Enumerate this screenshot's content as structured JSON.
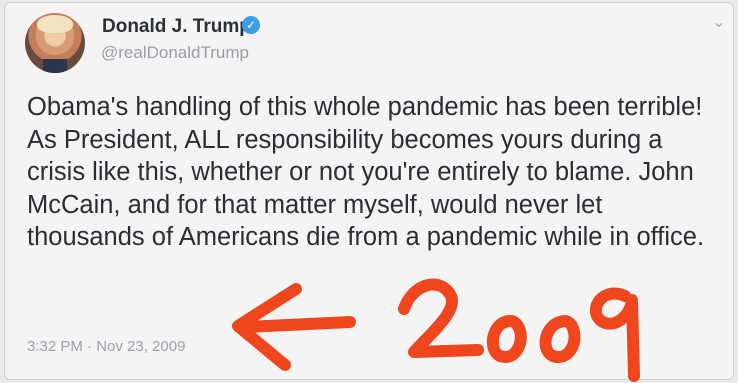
{
  "tweet": {
    "author_name": "Donald J. Trump",
    "author_handle": "@realDonaldTrump",
    "verified_icon": "verified-badge-icon",
    "menu_icon": "chevron-down-icon",
    "text": "Obama's handling of this whole pandemic has been terrible! As President, ALL responsibility becomes yours during a crisis like this, whether or not you're entirely to blame. John McCain, and for that matter myself, would never let thousands of Americans die from a pandemic while in office.",
    "timestamp": "3:32 PM · Nov 23, 2009"
  },
  "annotation": {
    "handwritten_text": "2009",
    "arrow_icon": "left-arrow-icon",
    "color": "#f0461e"
  },
  "colors": {
    "verified": "#3aa0e6",
    "text": "#2a2d31",
    "muted": "#9a9ea4"
  }
}
